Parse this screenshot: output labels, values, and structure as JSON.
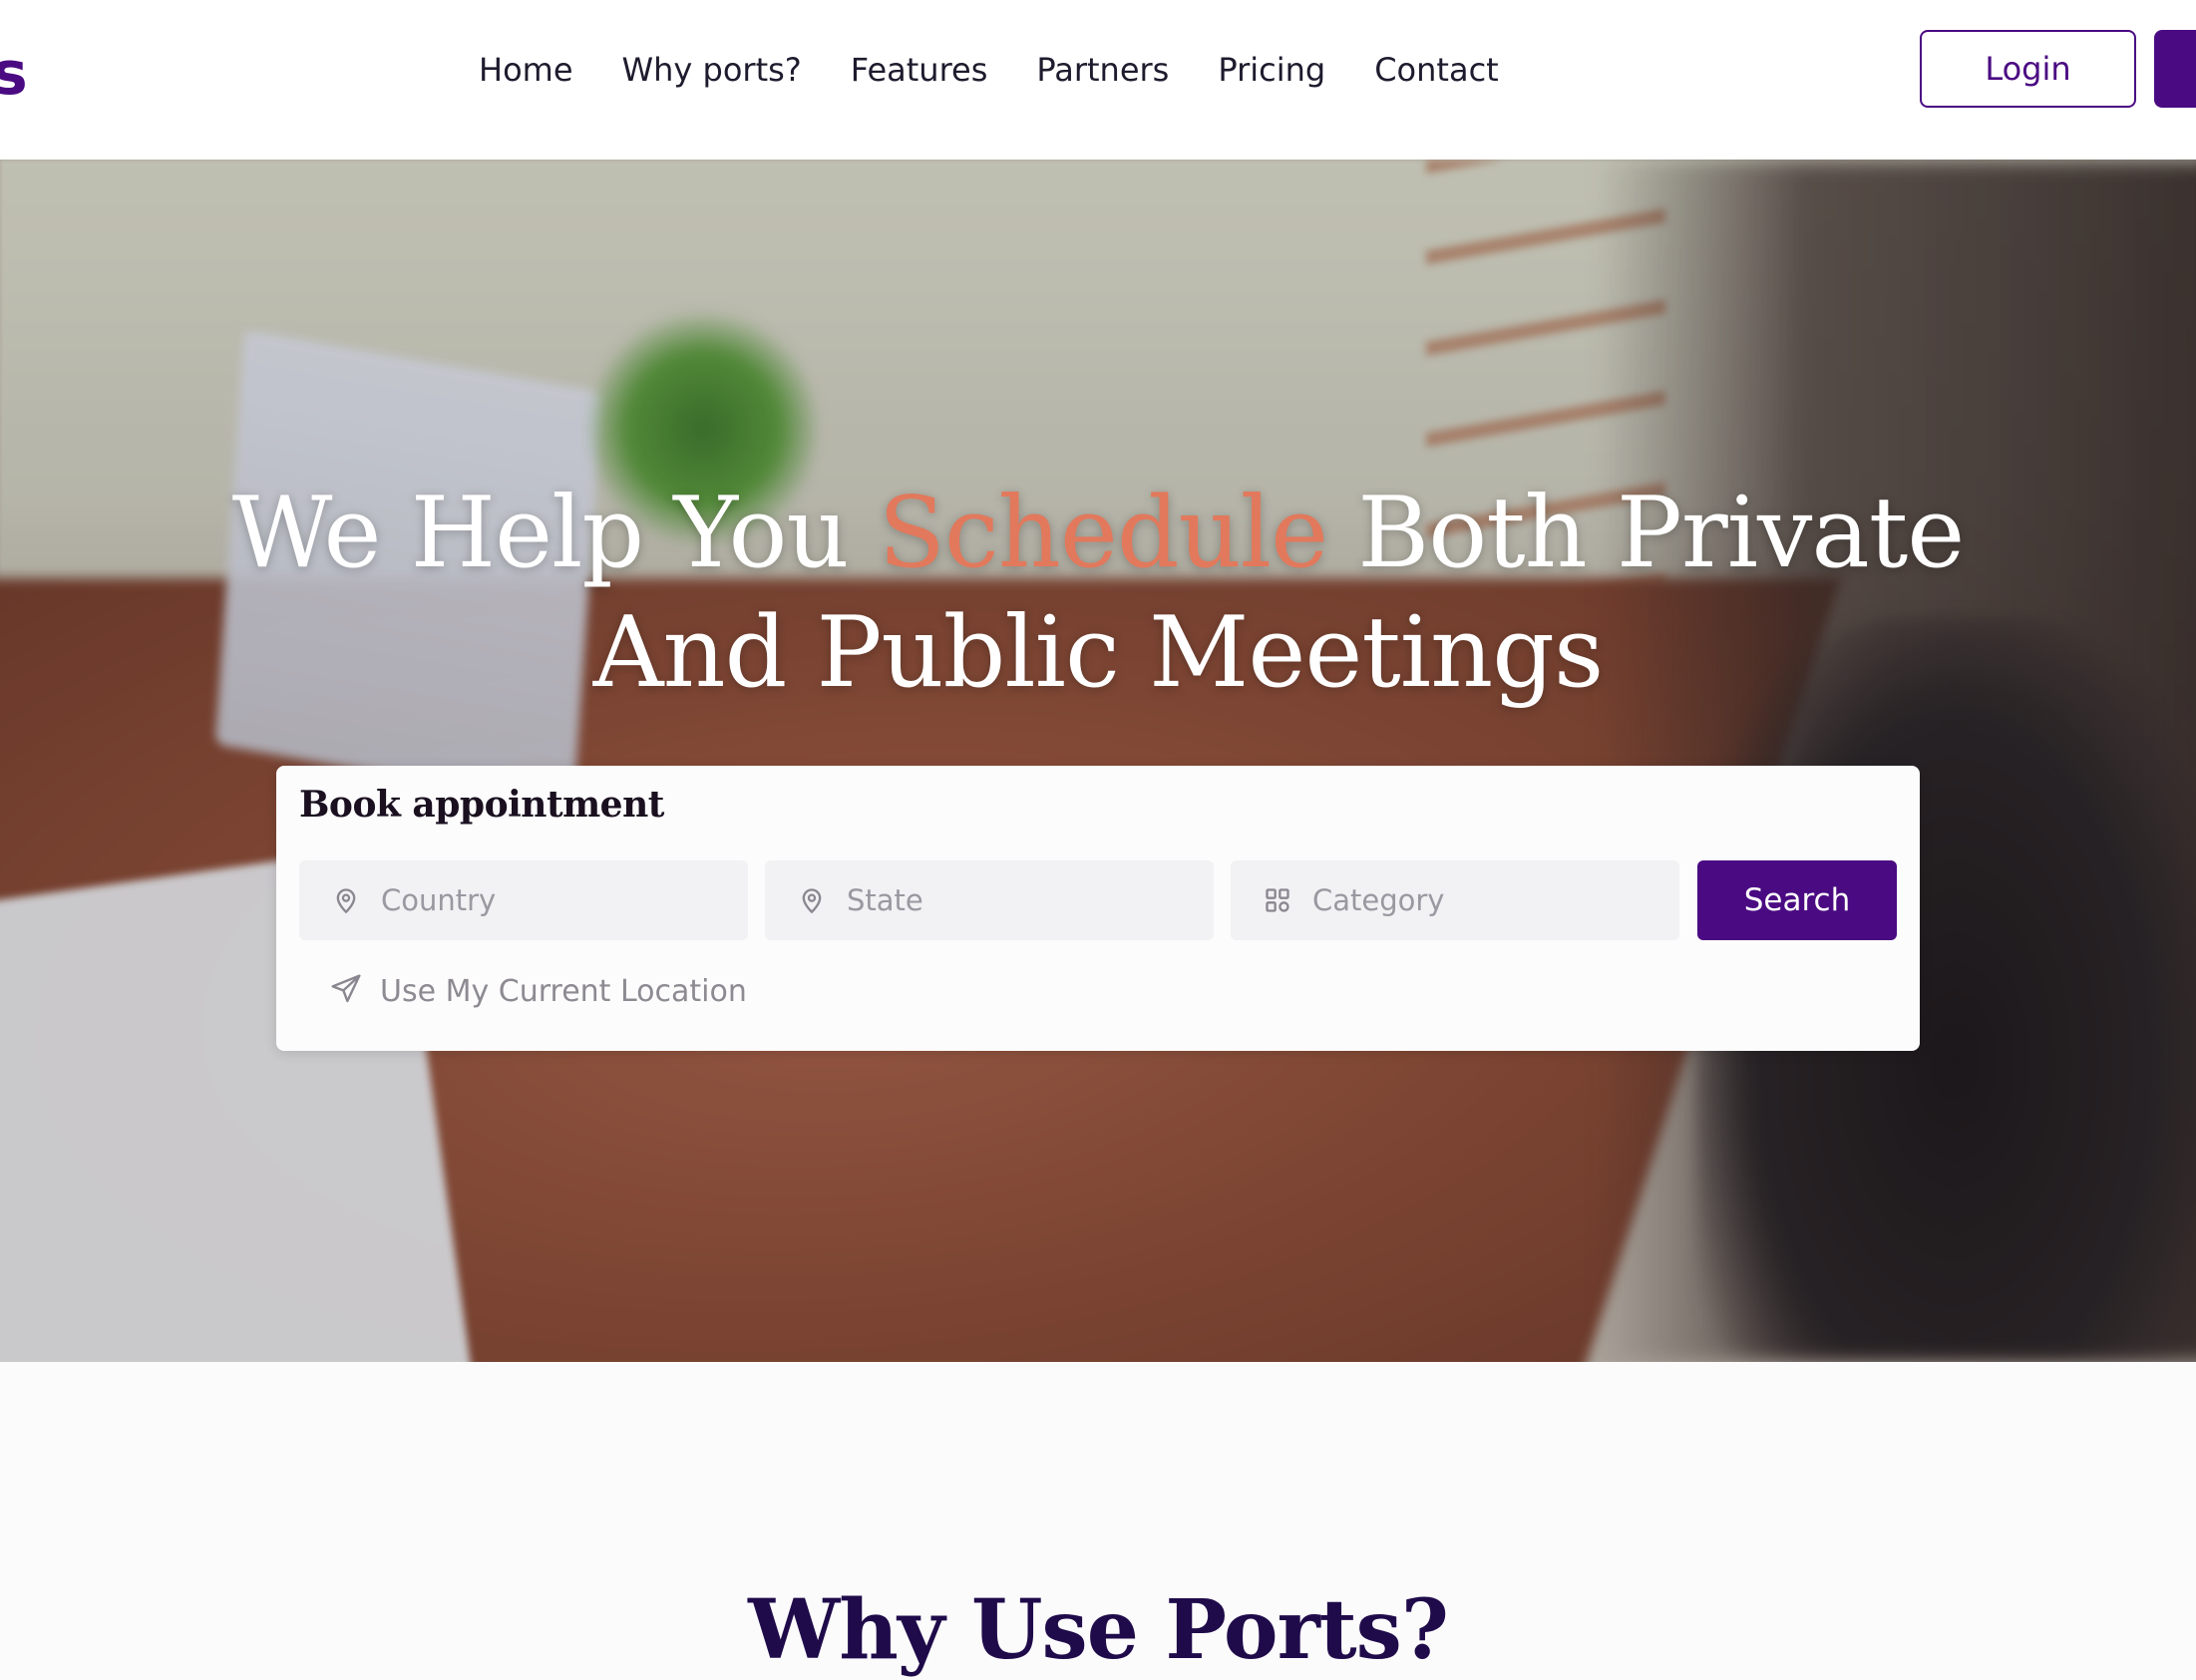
{
  "brand": {
    "logo_text": "s",
    "accent_color": "#4a0a82"
  },
  "nav": {
    "links": [
      "Home",
      "Why ports?",
      "Features",
      "Partners",
      "Pricing",
      "Contact"
    ],
    "login_label": "Login"
  },
  "hero": {
    "title_part1": "We Help You ",
    "title_accent": "Schedule",
    "title_part2": " Both Private",
    "title_line2": "And Public Meetings",
    "accent_color": "#e2795c"
  },
  "booking": {
    "title": "Book appointment",
    "country_placeholder": "Country",
    "state_placeholder": "State",
    "category_placeholder": "Category",
    "search_label": "Search",
    "location_label": "Use My Current Location",
    "icons": [
      "map-pin-icon",
      "map-pin-icon",
      "grid-icon",
      "send-icon"
    ]
  },
  "section": {
    "why_title": "Why Use Ports?"
  }
}
